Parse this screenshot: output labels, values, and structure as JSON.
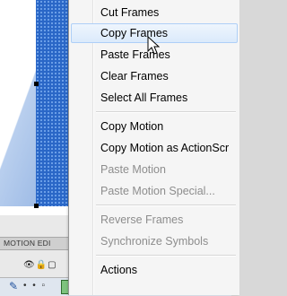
{
  "timeline": {
    "panel_label": "MOTION EDI",
    "layer_icons": "👁🔒▢"
  },
  "context_menu": {
    "items": [
      {
        "label": "Cut Frames",
        "enabled": true
      },
      {
        "label": "Copy Frames",
        "enabled": true,
        "hovered": true
      },
      {
        "label": "Paste Frames",
        "enabled": true
      },
      {
        "label": "Clear Frames",
        "enabled": true
      },
      {
        "label": "Select All Frames",
        "enabled": true
      },
      {
        "label": "Copy Motion",
        "enabled": true
      },
      {
        "label": "Copy Motion as ActionScr",
        "enabled": true
      },
      {
        "label": "Paste Motion",
        "enabled": false
      },
      {
        "label": "Paste Motion Special...",
        "enabled": false
      },
      {
        "label": "Reverse Frames",
        "enabled": false
      },
      {
        "label": "Synchronize Symbols",
        "enabled": false
      },
      {
        "label": "Actions",
        "enabled": true
      }
    ]
  },
  "colors": {
    "shape_fill": "#2a67c7",
    "hover_highlight": "#dbeafb",
    "disabled_text": "#8d8d8d",
    "tween_frames": "#7ec37e"
  }
}
